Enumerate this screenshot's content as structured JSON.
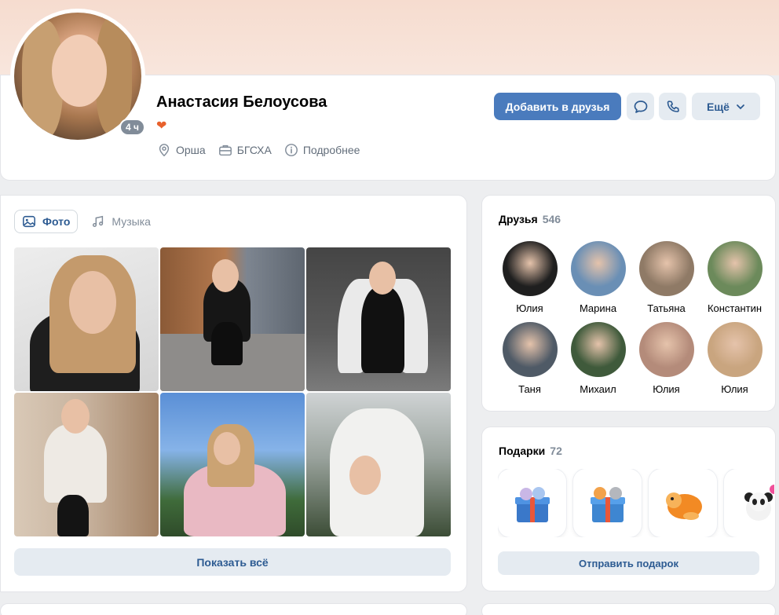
{
  "profile": {
    "name": "Анастасия Белоусова",
    "status_emoji": "❤",
    "online": "4 ч",
    "meta": [
      {
        "icon": "location-icon",
        "label": "Орша"
      },
      {
        "icon": "briefcase-icon",
        "label": "БГСХА"
      },
      {
        "icon": "info-icon",
        "label": "Подробнее"
      }
    ]
  },
  "actions": {
    "add_friend": "Добавить в друзья",
    "more": "Ещё"
  },
  "photos": {
    "tabs": [
      {
        "label": "Фото",
        "active": true
      },
      {
        "label": "Музыка",
        "active": false
      }
    ],
    "show_all": "Показать всё"
  },
  "friends": {
    "title": "Друзья",
    "count": "546",
    "items": [
      {
        "name": "Юлия",
        "color": "#1f1f1f"
      },
      {
        "name": "Марина",
        "color": "#6a8fb5"
      },
      {
        "name": "Татьяна",
        "color": "#8f7a66"
      },
      {
        "name": "Константин",
        "color": "#6c8a5b"
      },
      {
        "name": "Таня",
        "color": "#4f5a66"
      },
      {
        "name": "Михаил",
        "color": "#3f5a3b"
      },
      {
        "name": "Юлия",
        "color": "#b48b7a"
      },
      {
        "name": "Юлия",
        "color": "#c9a57f"
      }
    ]
  },
  "gifts": {
    "title": "Подарки",
    "count": "72",
    "send": "Отправить подарок"
  }
}
